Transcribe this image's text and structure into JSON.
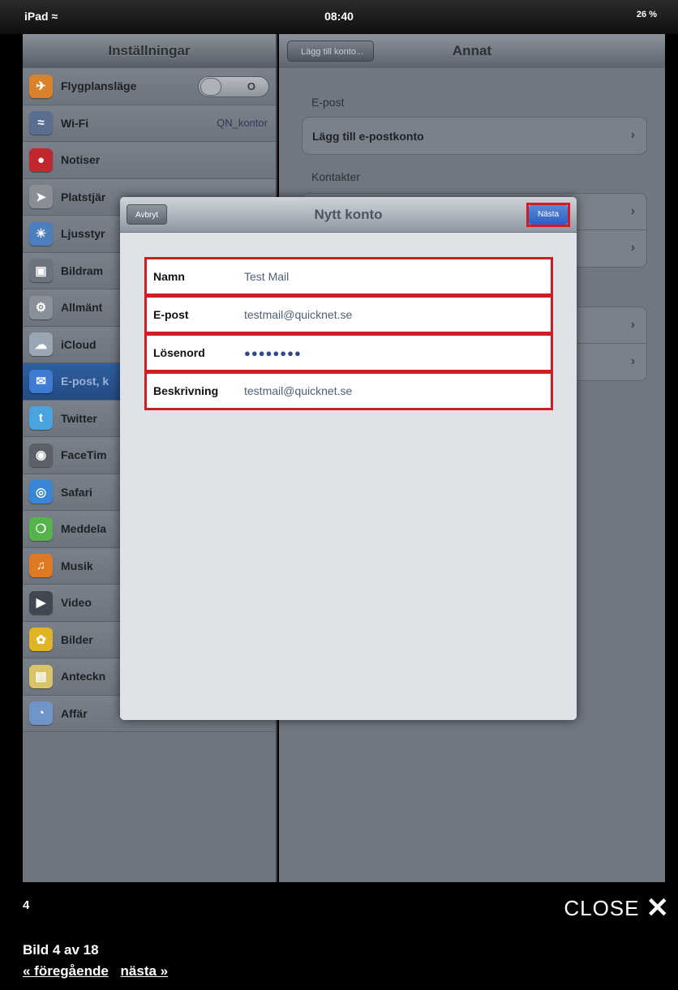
{
  "statusbar": {
    "device": "iPad ≈",
    "time": "08:40",
    "battery": "26 %"
  },
  "sidebar": {
    "title": "Inställningar",
    "items": [
      {
        "label": "Flygplansläge",
        "icon": "airplane-icon",
        "color": "#d9822b",
        "toggle": "O"
      },
      {
        "label": "Wi-Fi",
        "icon": "wifi-icon",
        "color": "#5a6f8f",
        "value": "QN_kontor"
      },
      {
        "label": "Notiser",
        "icon": "notifications-icon",
        "color": "#c0282d"
      },
      {
        "label": "Platstjär",
        "icon": "location-icon",
        "color": "#8a8f96"
      },
      {
        "label": "Ljusstyr",
        "icon": "brightness-icon",
        "color": "#4d7fbf"
      },
      {
        "label": "Bildram",
        "icon": "picture-frame-icon",
        "color": "#6c737c"
      },
      {
        "label": "Allmänt",
        "icon": "gear-icon",
        "color": "#8a9099"
      },
      {
        "label": "iCloud",
        "icon": "cloud-icon",
        "color": "#9aa6b4"
      },
      {
        "label": "E-post, k",
        "icon": "mail-icon",
        "color": "#3f7bd1"
      },
      {
        "label": "Twitter",
        "icon": "twitter-icon",
        "color": "#4aa3df"
      },
      {
        "label": "FaceTim",
        "icon": "facetime-icon",
        "color": "#5c6168"
      },
      {
        "label": "Safari",
        "icon": "safari-icon",
        "color": "#3a86d6"
      },
      {
        "label": "Meddela",
        "icon": "messages-icon",
        "color": "#56b24a"
      },
      {
        "label": "Musik",
        "icon": "music-icon",
        "color": "#e07a22"
      },
      {
        "label": "Video",
        "icon": "video-icon",
        "color": "#3e4752"
      },
      {
        "label": "Bilder",
        "icon": "photos-icon",
        "color": "#e0b424"
      },
      {
        "label": "Anteckn",
        "icon": "notes-icon",
        "color": "#d9c46a"
      },
      {
        "label": "Affär",
        "icon": "stocks-icon",
        "color": "#6f95c8"
      }
    ]
  },
  "detail": {
    "back_label": "Lägg till konto...",
    "title": "Annat",
    "section_mail": "E-post",
    "add_mail_account": "Lägg till e-postkonto",
    "section_contacts": "Kontakter"
  },
  "modal": {
    "title": "Nytt konto",
    "cancel_label": "Avbryt",
    "next_label": "Nästa",
    "fields": [
      {
        "label": "Namn",
        "value": "Test Mail"
      },
      {
        "label": "E-post",
        "value": "testmail@quicknet.se"
      },
      {
        "label": "Lösenord",
        "value": "●●●●●●●●"
      },
      {
        "label": "Beskrivning",
        "value": "testmail@quicknet.se"
      }
    ]
  },
  "footer": {
    "slide_number": "4",
    "close_label": "CLOSE",
    "close_glyph": "✕",
    "caption": "Bild 4 av 18",
    "prev_label": "« föregående",
    "next_label": "nästa »"
  }
}
